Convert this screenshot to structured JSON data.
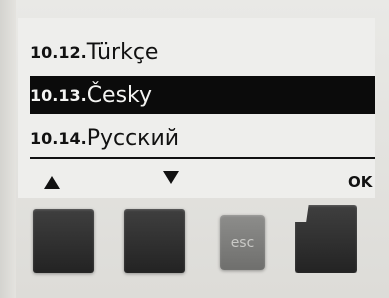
{
  "menu": {
    "items": [
      {
        "number": "10.12.",
        "label": "Türkçe",
        "selected": false
      },
      {
        "number": "10.13.",
        "label": "Česky",
        "selected": true
      },
      {
        "number": "10.14.",
        "label": "Русский",
        "selected": false
      }
    ]
  },
  "softkeys": {
    "up_icon": "triangle-up",
    "down_icon": "triangle-down",
    "ok_label": "OK"
  },
  "buttons": {
    "esc_label": "esc"
  },
  "colors": {
    "screen_bg": "#eeeeec",
    "highlight_bg": "#0b0b0b",
    "highlight_text": "#f4f4f2",
    "button_dark": "#2e2e2e",
    "button_esc": "#7e7e7c"
  }
}
